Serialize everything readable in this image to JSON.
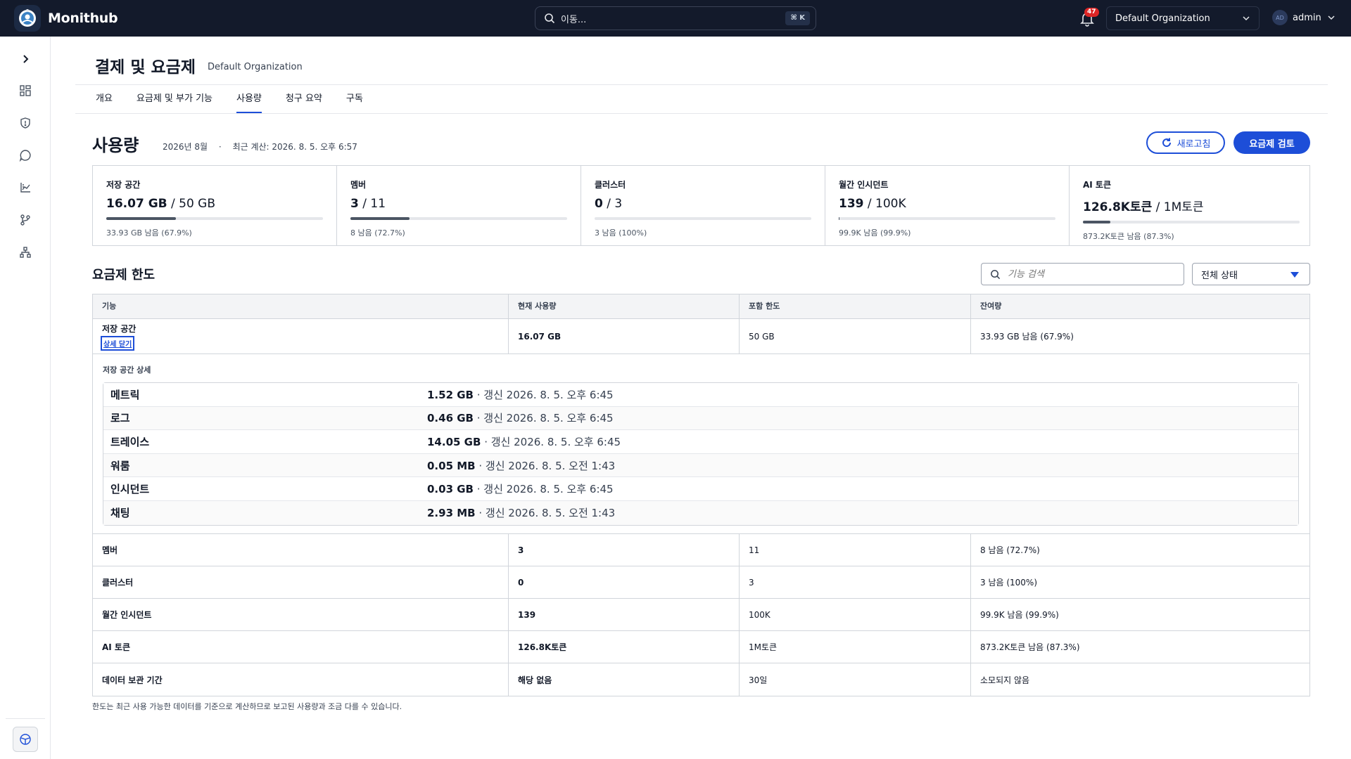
{
  "app": {
    "name": "Monithub"
  },
  "search": {
    "placeholder": "이동...",
    "shortcut": "⌘ K"
  },
  "notifications": {
    "count": "47"
  },
  "org_select": {
    "value": "Default Organization"
  },
  "user": {
    "initials": "AD",
    "name": "admin"
  },
  "page": {
    "title": "결제 및 요금제",
    "org": "Default Organization"
  },
  "tabs": [
    {
      "label": "개요",
      "active": false
    },
    {
      "label": "요금제 및 부가 기능",
      "active": false
    },
    {
      "label": "사용량",
      "active": true
    },
    {
      "label": "청구 요약",
      "active": false
    },
    {
      "label": "구독",
      "active": false
    }
  ],
  "usage": {
    "title": "사용량",
    "period": "2026년 8월",
    "separator": "·",
    "last_calc": "최근 계산: 2026. 8. 5. 오후 6:57",
    "refresh_label": "새로고침",
    "review_label": "요금제 검토"
  },
  "cards": [
    {
      "label": "저장 공간",
      "used": "16.07 GB",
      "limit": "/ 50 GB",
      "remaining": "33.93 GB 남음 (67.9%)",
      "fill_pct": 32.1
    },
    {
      "label": "멤버",
      "used": "3",
      "limit": "/ 11",
      "remaining": "8 남음 (72.7%)",
      "fill_pct": 27.3
    },
    {
      "label": "클러스터",
      "used": "0",
      "limit": "/ 3",
      "remaining": "3 남음 (100%)",
      "fill_pct": 0
    },
    {
      "label": "월간 인시던트",
      "used": "139",
      "limit": "/ 100K",
      "remaining": "99.9K 남음 (99.9%)",
      "fill_pct": 0.1
    },
    {
      "label": "AI 토큰",
      "used": "126.8K토큰",
      "limit": "/ 1M토큰",
      "remaining": "873.2K토큰 남음 (87.3%)",
      "fill_pct": 12.7
    }
  ],
  "limits": {
    "title": "요금제 한도",
    "search_placeholder": "기능 검색",
    "status_filter": "전체 상태",
    "headers": [
      "기능",
      "현재 사용량",
      "포함 한도",
      "잔여량"
    ],
    "storage_row": {
      "feature": "저장 공간",
      "toggle": "상세 닫기",
      "current": "16.07 GB",
      "limit": "50 GB",
      "remaining": "33.93 GB 남음 (67.9%)"
    },
    "storage_detail": {
      "title": "저장 공간 상세",
      "items": [
        {
          "name": "메트릭",
          "size": "1.52 GB",
          "updated": "· 갱신 2026. 8. 5. 오후 6:45"
        },
        {
          "name": "로그",
          "size": "0.46 GB",
          "updated": "· 갱신 2026. 8. 5. 오후 6:45"
        },
        {
          "name": "트레이스",
          "size": "14.05 GB",
          "updated": "· 갱신 2026. 8. 5. 오후 6:45"
        },
        {
          "name": "워룸",
          "size": "0.05 MB",
          "updated": "· 갱신 2026. 8. 5. 오전 1:43"
        },
        {
          "name": "인시던트",
          "size": "0.03 GB",
          "updated": "· 갱신 2026. 8. 5. 오후 6:45"
        },
        {
          "name": "채팅",
          "size": "2.93 MB",
          "updated": "· 갱신 2026. 8. 5. 오전 1:43"
        }
      ]
    },
    "rows": [
      {
        "feature": "멤버",
        "current": "3",
        "limit": "11",
        "remaining": "8 남음 (72.7%)"
      },
      {
        "feature": "클러스터",
        "current": "0",
        "limit": "3",
        "remaining": "3 남음 (100%)"
      },
      {
        "feature": "월간 인시던트",
        "current": "139",
        "limit": "100K",
        "remaining": "99.9K 남음 (99.9%)"
      },
      {
        "feature": "AI 토큰",
        "current": "126.8K토큰",
        "limit": "1M토큰",
        "remaining": "873.2K토큰 남음 (87.3%)"
      },
      {
        "feature": "데이터 보관 기간",
        "current": "해당 없음",
        "limit": "30일",
        "remaining": "소모되지 않음"
      }
    ],
    "footnote": "한도는 최근 사용 가능한 데이터를 기준으로 계산하므로 보고된 사용량과 조금 다를 수 있습니다."
  },
  "sidebar": {
    "icons": [
      "chevron-right-icon",
      "dashboard-grid-icon",
      "shield-icon",
      "chat-icon",
      "chart-icon",
      "git-branch-icon",
      "topology-icon"
    ]
  },
  "colors": {
    "topbar": "#131a2b",
    "accent": "#1d4ed8",
    "badge": "#dc2626"
  }
}
